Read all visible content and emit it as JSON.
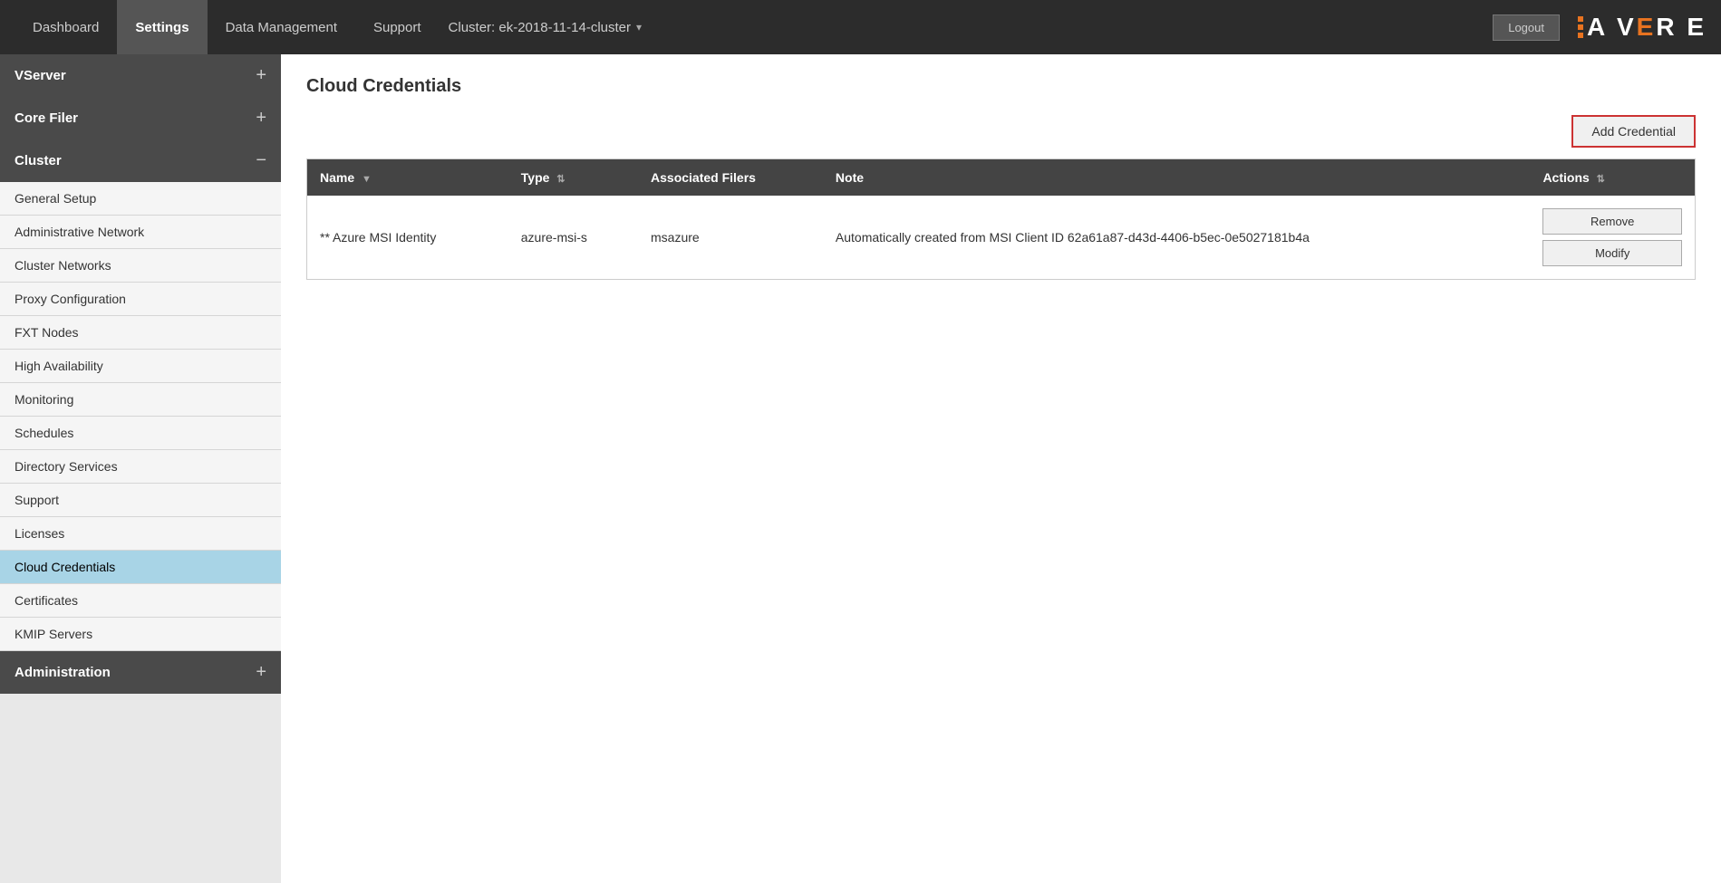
{
  "topbar": {
    "tabs": [
      {
        "label": "Dashboard",
        "active": false
      },
      {
        "label": "Settings",
        "active": true
      },
      {
        "label": "Data Management",
        "active": false
      },
      {
        "label": "Support",
        "active": false
      }
    ],
    "cluster_label": "Cluster: ek-2018-11-14-cluster",
    "logout_label": "Logout",
    "logo_text": "AV RE",
    "logo_e": "E"
  },
  "sidebar": {
    "sections": [
      {
        "label": "VServer",
        "icon": "+",
        "items": []
      },
      {
        "label": "Core Filer",
        "icon": "+",
        "items": []
      },
      {
        "label": "Cluster",
        "icon": "−",
        "items": [
          {
            "label": "General Setup",
            "active": false
          },
          {
            "label": "Administrative Network",
            "active": false
          },
          {
            "label": "Cluster Networks",
            "active": false
          },
          {
            "label": "Proxy Configuration",
            "active": false
          },
          {
            "label": "FXT Nodes",
            "active": false
          },
          {
            "label": "High Availability",
            "active": false
          },
          {
            "label": "Monitoring",
            "active": false
          },
          {
            "label": "Schedules",
            "active": false
          },
          {
            "label": "Directory Services",
            "active": false
          },
          {
            "label": "Support",
            "active": false
          },
          {
            "label": "Licenses",
            "active": false
          },
          {
            "label": "Cloud Credentials",
            "active": true
          },
          {
            "label": "Certificates",
            "active": false
          },
          {
            "label": "KMIP Servers",
            "active": false
          }
        ]
      },
      {
        "label": "Administration",
        "icon": "+",
        "items": []
      }
    ]
  },
  "main": {
    "page_title": "Cloud Credentials",
    "add_credential_label": "Add Credential",
    "table": {
      "columns": [
        {
          "label": "Name",
          "sortable": true
        },
        {
          "label": "Type",
          "sortable": true
        },
        {
          "label": "Associated Filers",
          "sortable": false
        },
        {
          "label": "Note",
          "sortable": false
        },
        {
          "label": "Actions",
          "sortable": true
        }
      ],
      "rows": [
        {
          "name": "** Azure MSI Identity",
          "type": "azure-msi-s",
          "associated_filers": "msazure",
          "note": "Automatically created from MSI Client ID 62a61a87-d43d-4406-b5ec-0e5027181b4a",
          "actions": [
            "Remove",
            "Modify"
          ]
        }
      ]
    }
  }
}
